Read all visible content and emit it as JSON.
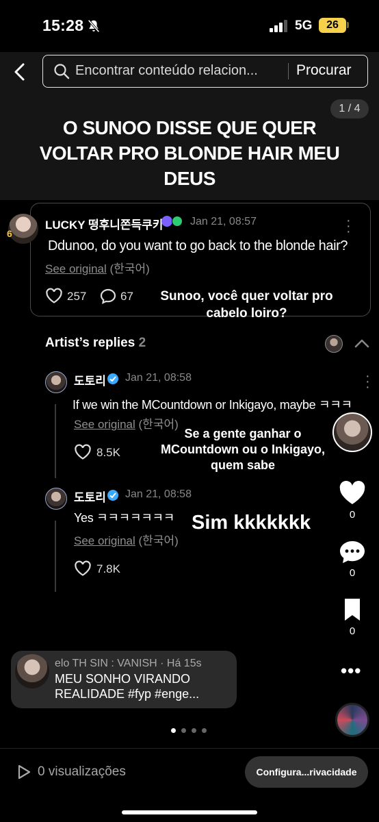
{
  "status_bar": {
    "time": "15:28",
    "network": "5G",
    "battery": "26"
  },
  "search": {
    "placeholder": "Encontrar conteúdo relacion...",
    "button": "Procurar"
  },
  "post": {
    "counter": "1 / 4",
    "overlay_title": "O SUNOO DISSE QUE QUER VOLTAR PRO BLONDE HAIR MEU DEUS"
  },
  "fan_post": {
    "badge": "6",
    "username": "LUCKY 떵후니쫀득쿠키",
    "time": "Jan 21, 08:57",
    "text": "Ddunoo, do you want to go back to the blonde hair?",
    "see_original": "See original",
    "original_lang": "(한국어)",
    "likes": "257",
    "comments": "67",
    "translation": "Sunoo, você quer voltar pro cabelo loiro?"
  },
  "artist_replies": {
    "title": "Artist’s replies",
    "count": "2",
    "replies": [
      {
        "name": "도토리",
        "time": "Jan 21, 08:58",
        "text": "If we win the MCountdown or Inkigayo, maybe ㅋㅋㅋ",
        "see_original": "See original",
        "original_lang": "(한국어)",
        "likes": "8.5K",
        "translation": "Se a gente ganhar o MCountdown ou o Inkigayo, quem sabe"
      },
      {
        "name": "도토리",
        "time": "Jan 21, 08:58",
        "text": "Yes ㅋㅋㅋㅋㅋㅋㅋ",
        "see_original": "See original",
        "original_lang": "(한국어)",
        "likes": "7.8K",
        "translation": "Sim kkkkkkk"
      }
    ]
  },
  "rail": {
    "likes": "0",
    "comments": "0",
    "saves": "0"
  },
  "comment": {
    "user": "elo TH SIN : VANISH · Há 15s",
    "text": "MEU SONHO VIRANDO REALIDADE #fyp #enge..."
  },
  "bottom": {
    "views": "0 visualizações",
    "privacy": "Configura...rivacidade"
  },
  "colors": {
    "battery": "#f7d14b",
    "verified": "#3ba9ff",
    "fan_verified_1": "#7b61ff",
    "fan_verified_2": "#2ecc71"
  }
}
